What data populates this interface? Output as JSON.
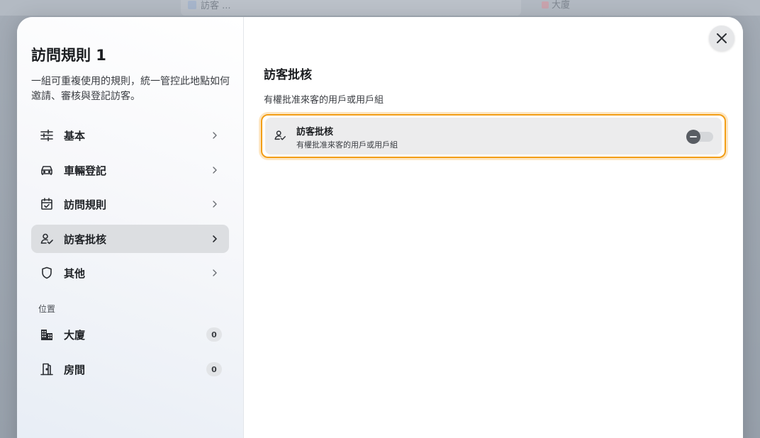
{
  "background": {
    "search_text": "訪客 ...",
    "tab_text": "大廈"
  },
  "sidebar": {
    "title": "訪問規則 1",
    "description": "一組可重複使用的規則，統一管控此地點如何邀請、審核與登記訪客。",
    "items": [
      {
        "label": "基本",
        "icon": "sliders-icon"
      },
      {
        "label": "車輛登記",
        "icon": "car-icon"
      },
      {
        "label": "訪問規則",
        "icon": "calendar-check-icon"
      },
      {
        "label": "訪客批核",
        "icon": "user-check-icon",
        "active": true
      },
      {
        "label": "其他",
        "icon": "shield-icon"
      }
    ],
    "location_section": {
      "label": "位置",
      "items": [
        {
          "label": "大廈",
          "count": "0",
          "icon": "building-icon"
        },
        {
          "label": "房間",
          "count": "0",
          "icon": "door-icon"
        }
      ]
    }
  },
  "main": {
    "title": "訪客批核",
    "description": "有權批准來客的用戶或用戶組",
    "card": {
      "title": "訪客批核",
      "subtitle": "有權批准來客的用戶或用戶組",
      "toggle_on": false
    }
  },
  "colors": {
    "accent_outline": "#f29e17",
    "active_nav": "#dcdee1"
  }
}
